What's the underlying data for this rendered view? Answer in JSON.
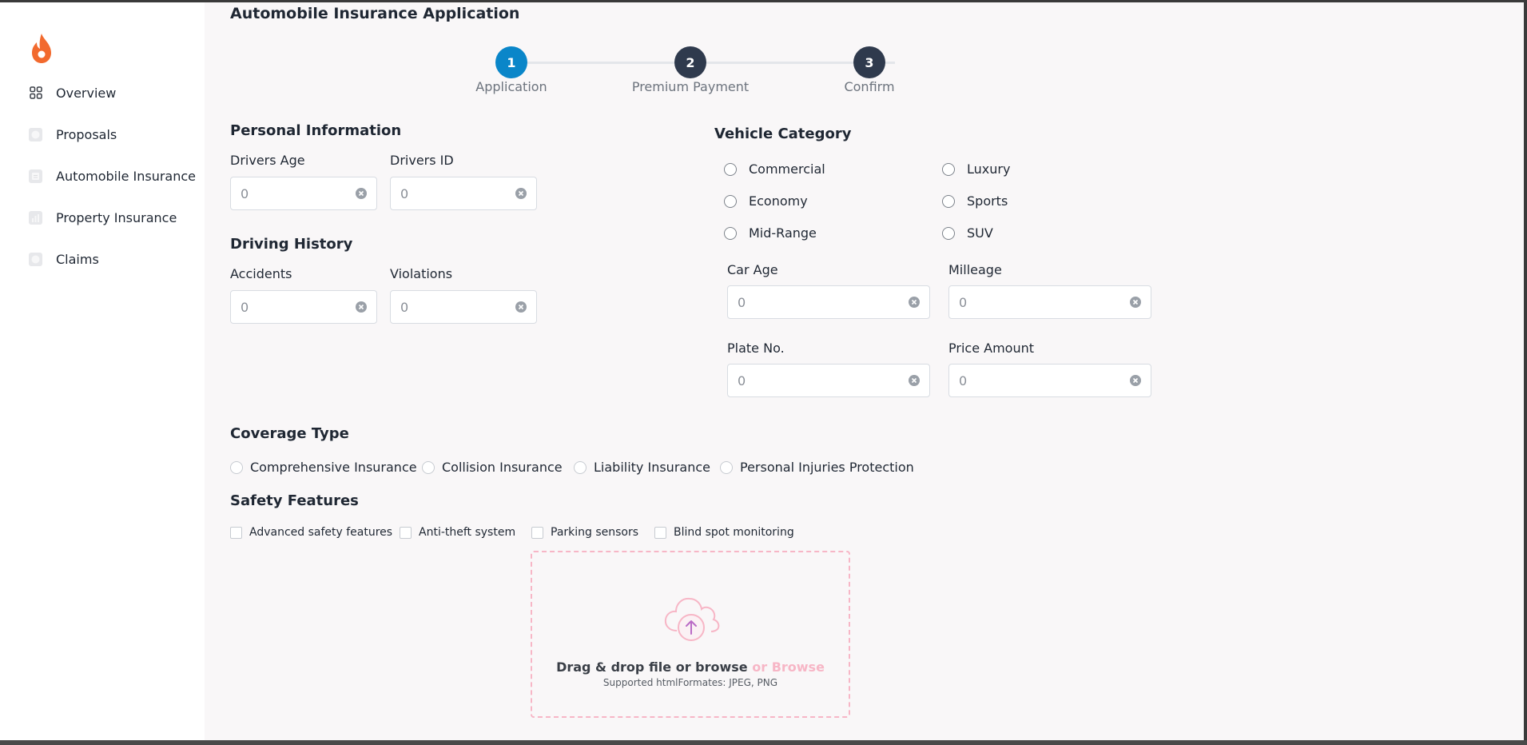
{
  "sidebar": {
    "items": [
      {
        "label": "Overview",
        "icon": "grid-icon"
      },
      {
        "label": "Proposals",
        "icon": "chat-icon"
      },
      {
        "label": "Automobile Insurance",
        "icon": "document-icon"
      },
      {
        "label": "Property Insurance",
        "icon": "bar-chart-icon"
      },
      {
        "label": "Claims",
        "icon": "chat-icon"
      }
    ]
  },
  "header": {
    "title": "Automobile Insurance Application"
  },
  "stepper": {
    "steps": [
      {
        "number": "1",
        "label": "Application",
        "active": true
      },
      {
        "number": "2",
        "label": "Premium Payment",
        "active": false
      },
      {
        "number": "3",
        "label": "Confirm",
        "active": false
      }
    ],
    "active_color": "#0a86c9",
    "inactive_color": "#2f3a4d"
  },
  "personal_info": {
    "title": "Personal Information",
    "drivers_age": {
      "label": "Drivers Age",
      "placeholder": "0"
    },
    "drivers_id": {
      "label": "Drivers ID",
      "placeholder": "0"
    }
  },
  "driving_history": {
    "title": "Driving History",
    "accidents": {
      "label": "Accidents",
      "placeholder": "0"
    },
    "violations": {
      "label": "Violations",
      "placeholder": "0"
    }
  },
  "vehicle_category": {
    "title": "Vehicle Category",
    "options": [
      "Commercial",
      "Luxury",
      "Economy",
      "Sports",
      "Mid-Range",
      "SUV"
    ],
    "car_age": {
      "label": "Car Age",
      "placeholder": "0"
    },
    "milleage": {
      "label": "Milleage",
      "placeholder": "0"
    },
    "plate_no": {
      "label": "Plate No.",
      "placeholder": "0"
    },
    "price_amount": {
      "label": "Price Amount",
      "placeholder": "0"
    }
  },
  "coverage_type": {
    "title": "Coverage Type",
    "options": [
      "Comprehensive Insurance",
      "Collision Insurance",
      "Liability Insurance",
      "Personal Injuries Protection"
    ]
  },
  "safety_features": {
    "title": "Safety Features",
    "options": [
      "Advanced safety features",
      "Anti-theft system",
      "Parking sensors",
      "Blind spot monitoring"
    ]
  },
  "upload": {
    "main_text": "Drag & drop file or browse",
    "browse_text": "or Browse",
    "sub_text": "Supported htmlFormates: JPEG, PNG",
    "accent_color": "#f7b6c6"
  },
  "colors": {
    "brand": "#f26a2e",
    "background": "#f9f7f8"
  }
}
